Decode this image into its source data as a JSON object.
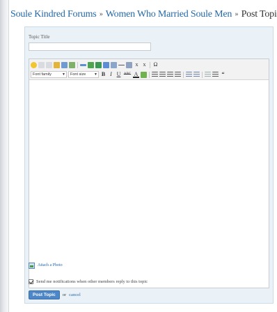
{
  "breadcrumb": {
    "items": [
      "Soule Kindred Forums",
      "Women Who Married Soule Men"
    ],
    "separator": "»",
    "current": "Post Topic"
  },
  "form": {
    "topic_title_label": "Topic Title",
    "topic_title_value": ""
  },
  "toolbar": {
    "row1_icons": [
      "help-icon",
      "undo-icon",
      "redo-icon",
      "cleanup-icon",
      "link-icon",
      "image-icon",
      "horizontal-rule-icon",
      "table-icon",
      "emoticon-icon",
      "media-icon",
      "anchor-icon",
      "hr-icon",
      "remove-format-icon",
      "subscript-icon",
      "superscript-icon",
      "special-char-icon"
    ],
    "font_family_label": "Font family",
    "font_size_label": "Font size",
    "bold": "B",
    "italic": "I",
    "underline": "U",
    "strike": "ABC",
    "font_color": "A",
    "omega": "Ω"
  },
  "attach": {
    "label": "Attach a Photo"
  },
  "notify": {
    "label": "Send me notifications when other members reply to this topic",
    "checked": true
  },
  "actions": {
    "post_label": "Post Topic",
    "or_text": "or",
    "cancel_label": "cancel"
  },
  "colors": {
    "link": "#2468a8",
    "form_bg": "#eaf2f8",
    "button": "#4d87c7"
  }
}
